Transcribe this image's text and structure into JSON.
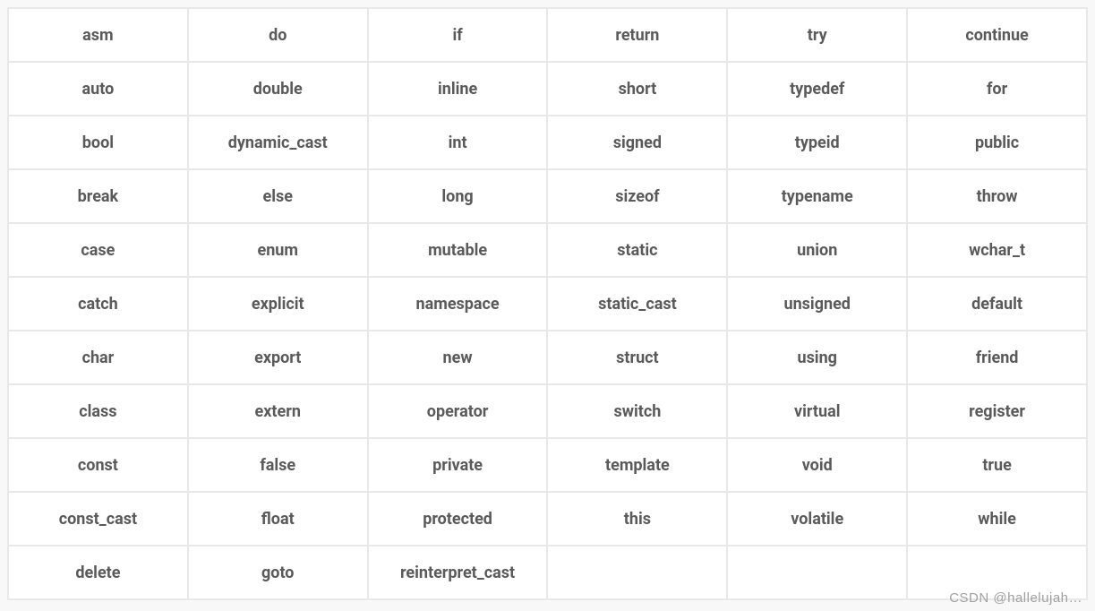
{
  "table": {
    "rows": [
      [
        "asm",
        "do",
        "if",
        "return",
        "try",
        "continue"
      ],
      [
        "auto",
        "double",
        "inline",
        "short",
        "typedef",
        "for"
      ],
      [
        "bool",
        "dynamic_cast",
        "int",
        "signed",
        "typeid",
        "public"
      ],
      [
        "break",
        "else",
        "long",
        "sizeof",
        "typename",
        "throw"
      ],
      [
        "case",
        "enum",
        "mutable",
        "static",
        "union",
        "wchar_t"
      ],
      [
        "catch",
        "explicit",
        "namespace",
        "static_cast",
        "unsigned",
        "default"
      ],
      [
        "char",
        "export",
        "new",
        "struct",
        "using",
        "friend"
      ],
      [
        "class",
        "extern",
        "operator",
        "switch",
        "virtual",
        "register"
      ],
      [
        "const",
        "false",
        "private",
        "template",
        "void",
        "true"
      ],
      [
        "const_cast",
        "float",
        "protected",
        "this",
        "volatile",
        "while"
      ],
      [
        "delete",
        "goto",
        "reinterpret_cast",
        "",
        "",
        ""
      ]
    ]
  },
  "watermark": "CSDN @hallelujah…"
}
